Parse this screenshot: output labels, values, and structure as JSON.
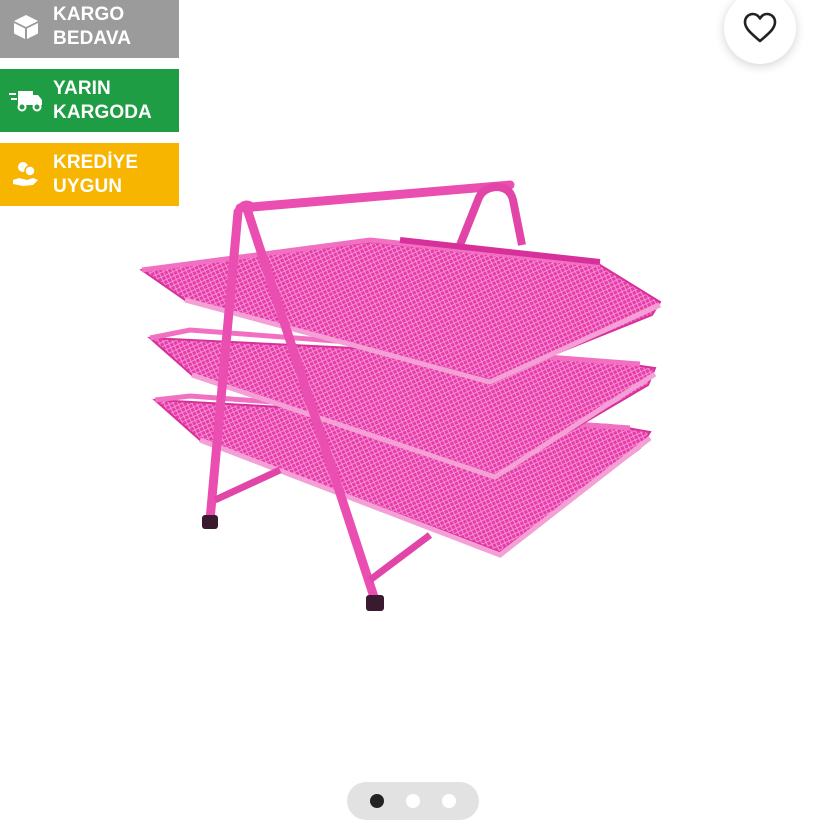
{
  "badges": [
    {
      "line1": "KARGO",
      "line2": "BEDAVA",
      "icon": "package-icon",
      "color": "#9b9b9b"
    },
    {
      "line1": "YARIN",
      "line2": "KARGODA",
      "icon": "delivery-truck-icon",
      "color": "#1f9d45"
    },
    {
      "line1": "KREDİYE",
      "line2": "UYGUN",
      "icon": "credit-hand-icon",
      "color": "#f7b500"
    }
  ],
  "favorite": {
    "icon": "heart-icon"
  },
  "product_image": {
    "subject": "pink 3-tier mesh document tray",
    "color": "#e83aa9"
  },
  "carousel": {
    "count": 3,
    "active_index": 0,
    "active_color": "#222222",
    "inactive_color": "#ffffff"
  }
}
